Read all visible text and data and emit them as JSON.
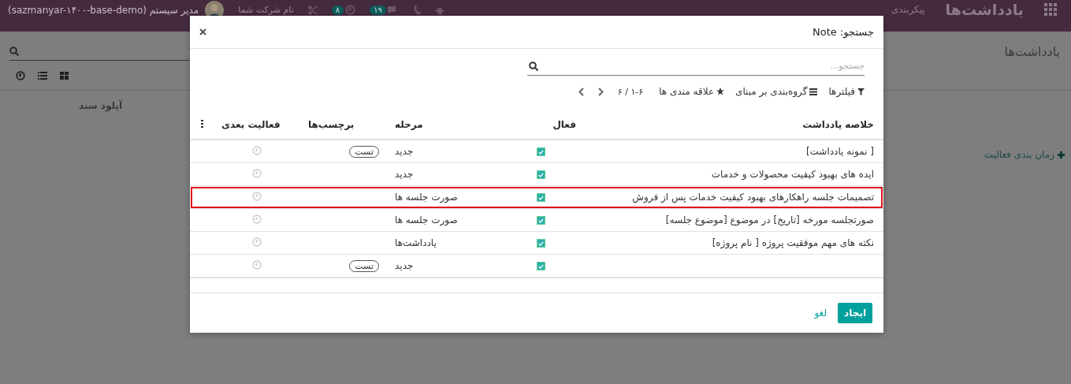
{
  "topbar": {
    "app_title": "یادداشت‌ها",
    "menu": [
      "پیکربندی"
    ],
    "company": "نام شرکت شما",
    "user": "مدیر سیستم (sazmanyar-۱۴۰۰-base-demo)",
    "badges": [
      {
        "kind": "chat",
        "count": "۱۹"
      },
      {
        "kind": "activity",
        "count": "۸"
      }
    ]
  },
  "control_panel": {
    "breadcrumb": "یادداشت‌ها",
    "views": [
      {
        "kind": "activity"
      },
      {
        "kind": "list"
      },
      {
        "kind": "kanban"
      }
    ]
  },
  "background": {
    "upload_label": "آپلود سند",
    "schedule_label": "زمان بندی فعالیت"
  },
  "dialog": {
    "title": "جستجو: Note",
    "search": {
      "placeholder": "جستجو..."
    },
    "filters": "فیلترها",
    "group_by": "گروه‌بندی بر مبنای",
    "favorites": "علاقه مندی ها",
    "pager": "۱-۶ / ۶",
    "columns": [
      "خلاصه یادداشت",
      "فعال",
      "مرحله",
      "برچسب‌ها",
      "فعالیت بعدی"
    ],
    "rows": [
      {
        "summary": "[ نمونه یادداشت]",
        "active": true,
        "stage": "جدید",
        "tag": "تست",
        "highlighted": false
      },
      {
        "summary": "ایده های بهبود کیفیت محصولات و خدمات",
        "active": true,
        "stage": "جدید",
        "highlighted": false
      },
      {
        "summary": "تصمیمات جلسه راهکارهای بهبود کیفیت خدمات پس از فروش",
        "active": true,
        "stage": "صورت جلسه ها",
        "highlighted": true
      },
      {
        "summary": "صورتجلسه مورخه [تاریخ] در موضوع [موضوع جلسه]",
        "active": true,
        "stage": "صورت جلسه ها",
        "highlighted": false
      },
      {
        "summary": "نکته های مهم موفقیت پروژه [ نام پروژه]",
        "active": true,
        "stage": "یادداشت‌ها",
        "highlighted": false
      },
      {
        "active": true,
        "stage": "جدید",
        "tag": "تست",
        "highlighted": false
      }
    ],
    "buttons": [
      {
        "label": "ایجاد",
        "kind": "primary"
      },
      {
        "label": "لغو",
        "kind": "link"
      }
    ]
  }
}
